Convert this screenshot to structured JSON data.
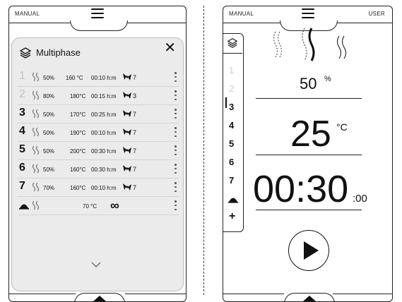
{
  "left_panel": {
    "mode_label": "MANUAL",
    "popup": {
      "title": "Multiphase",
      "close_symbol": "✕",
      "phases": [
        {
          "num": "1",
          "humidity": "50%",
          "temp": "160 °C",
          "time": "00:10 h:m",
          "fan": "7",
          "dim": true
        },
        {
          "num": "2",
          "humidity": "80%",
          "temp": "180°C",
          "time": "00:15 h:m",
          "fan": "3",
          "dim": true
        },
        {
          "num": "3",
          "humidity": "50%",
          "temp": "170°C",
          "time": "00:25 h:m",
          "fan": "7",
          "dim": false
        },
        {
          "num": "4",
          "humidity": "50%",
          "temp": "190°C",
          "time": "00:10 h:m",
          "fan": "7",
          "dim": false
        },
        {
          "num": "5",
          "humidity": "50%",
          "temp": "200°C",
          "time": "00:30 h:m",
          "fan": "7",
          "dim": false
        },
        {
          "num": "6",
          "humidity": "50%",
          "temp": "160°C",
          "time": "00:30 h:m",
          "fan": "7",
          "dim": false
        },
        {
          "num": "7",
          "humidity": "70%",
          "temp": "160°C",
          "time": "00:10 h:m",
          "fan": "7",
          "dim": false
        }
      ],
      "hold_row": {
        "temp": "70 °C",
        "time": "∞"
      }
    }
  },
  "right_panel": {
    "mode_label": "MANUAL",
    "user_label": "USER",
    "sidebar_items": [
      {
        "label": "1",
        "dim": true
      },
      {
        "label": "2",
        "dim": true
      },
      {
        "label": "3",
        "dim": false
      },
      {
        "label": "4",
        "dim": false
      },
      {
        "label": "5",
        "dim": false
      },
      {
        "label": "6",
        "dim": false
      },
      {
        "label": "7",
        "dim": false
      }
    ],
    "add_label": "+",
    "humidity": "50",
    "humidity_unit": "%",
    "temperature": "25",
    "temperature_unit": "°C",
    "time_main": "00:30",
    "time_seconds": ":00"
  },
  "colors": {
    "ink": "#111111",
    "popup_bg": "#ebebeb",
    "dim_text": "#c4c4c4"
  }
}
